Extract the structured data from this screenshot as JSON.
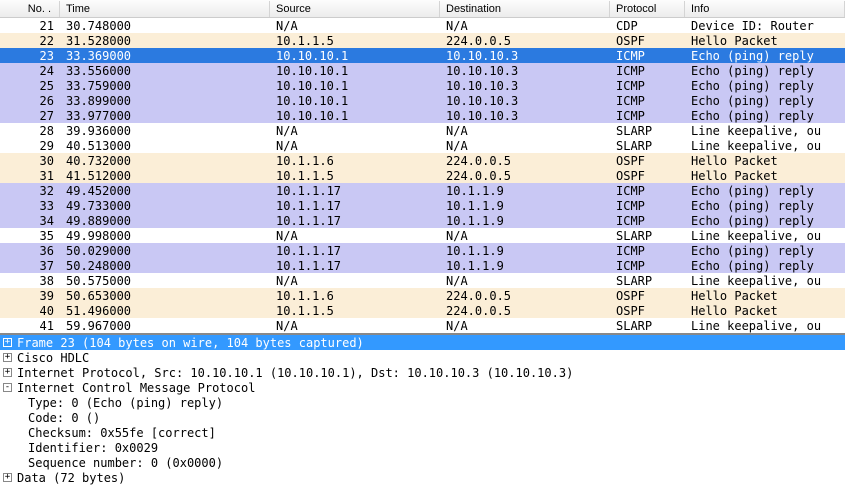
{
  "columns": {
    "no": "No. .",
    "time": "Time",
    "source": "Source",
    "destination": "Destination",
    "protocol": "Protocol",
    "info": "Info"
  },
  "rows": [
    {
      "no": "21",
      "time": "30.748000",
      "src": "N/A",
      "dst": "N/A",
      "proto": "CDP",
      "info": "Device ID: Router",
      "bg": "none"
    },
    {
      "no": "22",
      "time": "31.528000",
      "src": "10.1.1.5",
      "dst": "224.0.0.5",
      "proto": "OSPF",
      "info": "Hello Packet",
      "bg": "ospf"
    },
    {
      "no": "23",
      "time": "33.369000",
      "src": "10.10.10.1",
      "dst": "10.10.10.3",
      "proto": "ICMP",
      "info": "Echo (ping) reply",
      "bg": "selected"
    },
    {
      "no": "24",
      "time": "33.556000",
      "src": "10.10.10.1",
      "dst": "10.10.10.3",
      "proto": "ICMP",
      "info": "Echo (ping) reply",
      "bg": "icmp"
    },
    {
      "no": "25",
      "time": "33.759000",
      "src": "10.10.10.1",
      "dst": "10.10.10.3",
      "proto": "ICMP",
      "info": "Echo (ping) reply",
      "bg": "icmp"
    },
    {
      "no": "26",
      "time": "33.899000",
      "src": "10.10.10.1",
      "dst": "10.10.10.3",
      "proto": "ICMP",
      "info": "Echo (ping) reply",
      "bg": "icmp"
    },
    {
      "no": "27",
      "time": "33.977000",
      "src": "10.10.10.1",
      "dst": "10.10.10.3",
      "proto": "ICMP",
      "info": "Echo (ping) reply",
      "bg": "icmp"
    },
    {
      "no": "28",
      "time": "39.936000",
      "src": "N/A",
      "dst": "N/A",
      "proto": "SLARP",
      "info": "Line keepalive, ou",
      "bg": "none"
    },
    {
      "no": "29",
      "time": "40.513000",
      "src": "N/A",
      "dst": "N/A",
      "proto": "SLARP",
      "info": "Line keepalive, ou",
      "bg": "none"
    },
    {
      "no": "30",
      "time": "40.732000",
      "src": "10.1.1.6",
      "dst": "224.0.0.5",
      "proto": "OSPF",
      "info": "Hello Packet",
      "bg": "ospf"
    },
    {
      "no": "31",
      "time": "41.512000",
      "src": "10.1.1.5",
      "dst": "224.0.0.5",
      "proto": "OSPF",
      "info": "Hello Packet",
      "bg": "ospf"
    },
    {
      "no": "32",
      "time": "49.452000",
      "src": "10.1.1.17",
      "dst": "10.1.1.9",
      "proto": "ICMP",
      "info": "Echo (ping) reply",
      "bg": "icmp"
    },
    {
      "no": "33",
      "time": "49.733000",
      "src": "10.1.1.17",
      "dst": "10.1.1.9",
      "proto": "ICMP",
      "info": "Echo (ping) reply",
      "bg": "icmp"
    },
    {
      "no": "34",
      "time": "49.889000",
      "src": "10.1.1.17",
      "dst": "10.1.1.9",
      "proto": "ICMP",
      "info": "Echo (ping) reply",
      "bg": "icmp"
    },
    {
      "no": "35",
      "time": "49.998000",
      "src": "N/A",
      "dst": "N/A",
      "proto": "SLARP",
      "info": "Line keepalive, ou",
      "bg": "none"
    },
    {
      "no": "36",
      "time": "50.029000",
      "src": "10.1.1.17",
      "dst": "10.1.1.9",
      "proto": "ICMP",
      "info": "Echo (ping) reply",
      "bg": "icmp"
    },
    {
      "no": "37",
      "time": "50.248000",
      "src": "10.1.1.17",
      "dst": "10.1.1.9",
      "proto": "ICMP",
      "info": "Echo (ping) reply",
      "bg": "icmp"
    },
    {
      "no": "38",
      "time": "50.575000",
      "src": "N/A",
      "dst": "N/A",
      "proto": "SLARP",
      "info": "Line keepalive, ou",
      "bg": "none"
    },
    {
      "no": "39",
      "time": "50.653000",
      "src": "10.1.1.6",
      "dst": "224.0.0.5",
      "proto": "OSPF",
      "info": "Hello Packet",
      "bg": "ospf"
    },
    {
      "no": "40",
      "time": "51.496000",
      "src": "10.1.1.5",
      "dst": "224.0.0.5",
      "proto": "OSPF",
      "info": "Hello Packet",
      "bg": "ospf"
    },
    {
      "no": "41",
      "time": "59.967000",
      "src": "N/A",
      "dst": "N/A",
      "proto": "SLARP",
      "info": "Line keepalive, ou",
      "bg": "none"
    }
  ],
  "detail": {
    "frame": "Frame 23 (104 bytes on wire, 104 bytes captured)",
    "l2": "Cisco HDLC",
    "ip": "Internet Protocol, Src: 10.10.10.1 (10.10.10.1), Dst: 10.10.10.3 (10.10.10.3)",
    "icmp": "Internet Control Message Protocol",
    "type": "Type: 0 (Echo (ping) reply)",
    "code": "Code: 0 ()",
    "checksum": "Checksum: 0x55fe [correct]",
    "identifier": "Identifier: 0x0029",
    "seq": "Sequence number: 0 (0x0000)",
    "data": "Data (72 bytes)"
  }
}
